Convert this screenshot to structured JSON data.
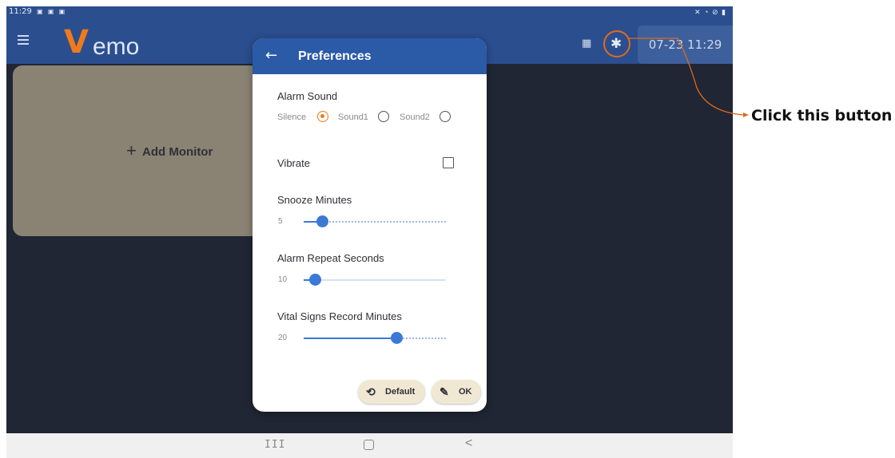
{
  "statusbar": {
    "time": "11:29",
    "left_icons": "▣ ▣ ▣",
    "right_icons": "✕ ◔ ⊘ ▮"
  },
  "appbar": {
    "logo_v": "V",
    "logo_rest": "emo",
    "grid_icon": "▦",
    "gear_icon": "✱",
    "datetime": "07-23 11:29"
  },
  "main": {
    "add_plus": "+",
    "add_monitor_label": "Add Monitor"
  },
  "dialog": {
    "back_icon": "←",
    "title": "Preferences",
    "alarm_sound": {
      "label": "Alarm Sound",
      "options": [
        {
          "label": "Silence",
          "selected": true
        },
        {
          "label": "Sound1",
          "selected": false
        },
        {
          "label": "Sound2",
          "selected": false
        }
      ]
    },
    "vibrate": {
      "label": "Vibrate",
      "checked": false
    },
    "snooze": {
      "label": "Snooze Minutes",
      "value": "5",
      "fraction": 0.13
    },
    "alarm_repeat": {
      "label": "Alarm Repeat Seconds",
      "value": "10",
      "fraction": 0.08
    },
    "vital_signs": {
      "label": "Vital Signs Record Minutes",
      "value": "20",
      "fraction": 0.65
    },
    "default_button": {
      "icon": "⟲",
      "label": "Default"
    },
    "ok_button": {
      "icon": "✎",
      "label": "OK"
    }
  },
  "navbar": {
    "recents": "III",
    "back": "<"
  },
  "callout": {
    "text": "Click this button",
    "color": "#e06a1e"
  }
}
